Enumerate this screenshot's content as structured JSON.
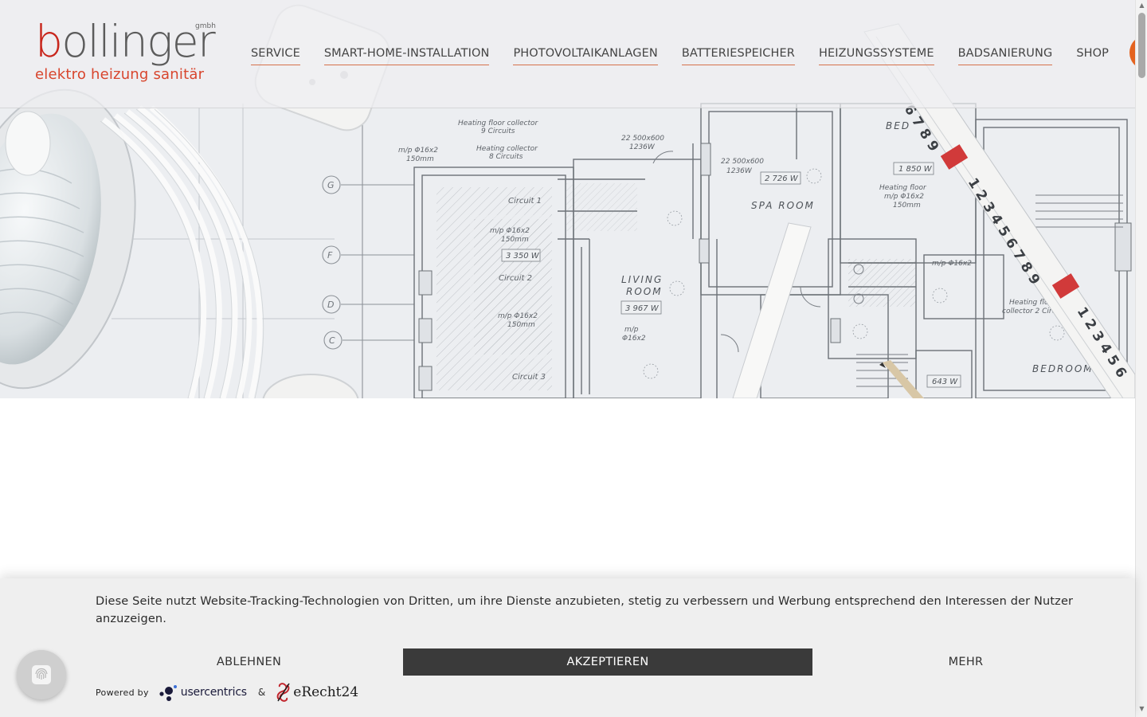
{
  "brand": {
    "name_first": "b",
    "name_rest": "ollinger",
    "suffix": "gmbh",
    "tagline": "elektro heizung sanitär"
  },
  "nav": {
    "items": [
      {
        "label": "SERVICE"
      },
      {
        "label": "SMART-HOME-INSTALLATION"
      },
      {
        "label": "PHOTOVOLTAIKANLAGEN"
      },
      {
        "label": "BATTERIESPEICHER"
      },
      {
        "label": "HEIZUNGSSYSTEME"
      },
      {
        "label": "BADSANIERUNG"
      },
      {
        "label": "SHOP"
      }
    ]
  },
  "hero": {
    "blueprint_labels": {
      "spa_room": "SPA ROOM",
      "living_room": "LIVING",
      "living_room2": "ROOM",
      "bedroom": "BEDROOM",
      "circuit1": "Circuit 1",
      "circuit2": "Circuit 2",
      "circuit3": "Circuit 3",
      "w1": "3 350 W",
      "w2": "3 967 W",
      "w3": "2 726 W",
      "w4": "1 850 W",
      "w5": "643 W",
      "hf1": "Heating floor collector",
      "hf1b": "9 Circuits",
      "hf2": "Heating collector",
      "hf2b": "8 Circuits",
      "hf3": "Heating floor",
      "hf3b": "m/p Φ16x2",
      "hf3c": "150mm",
      "hf4": "Heating floor",
      "hf4b": "collector 2 Circuit",
      "mp1": "m/p Φ16x2",
      "mp1b": "150mm",
      "mp2": "m/p Φ16x2",
      "mp2b": "150mm",
      "mp3": "m/p Φ16x2",
      "mp3b": "150mm",
      "mp4": "m/p",
      "mp4b": "Φ16x2",
      "mp5": "m/p Φ16x2",
      "dim1": "22 500x600",
      "dim1b": "1236W",
      "dim2": "22 500x600",
      "dim2b": "1236W",
      "axis_g": "G",
      "axis_f": "F",
      "axis_d": "D",
      "axis_c": "C",
      "bed_partial": "BED"
    }
  },
  "cookie": {
    "text": "Diese Seite nutzt Website-Tracking-Technologien von Dritten, um ihre Dienste anzubieten, stetig zu verbessern und Werbung entsprechend den Interessen der Nutzer anzuzeigen.",
    "decline": "ABLEHNEN",
    "accept": "AKZEPTIEREN",
    "more": "MEHR",
    "powered_by": "Powered by",
    "uc_name": "usercentrics",
    "amp": "&",
    "erecht_name": "eRecht24"
  },
  "colors": {
    "brand_red": "#c8261c",
    "brand_orange": "#d8452d",
    "accent_orange": "#e4631f",
    "accept_bg": "#3a3a3a"
  }
}
